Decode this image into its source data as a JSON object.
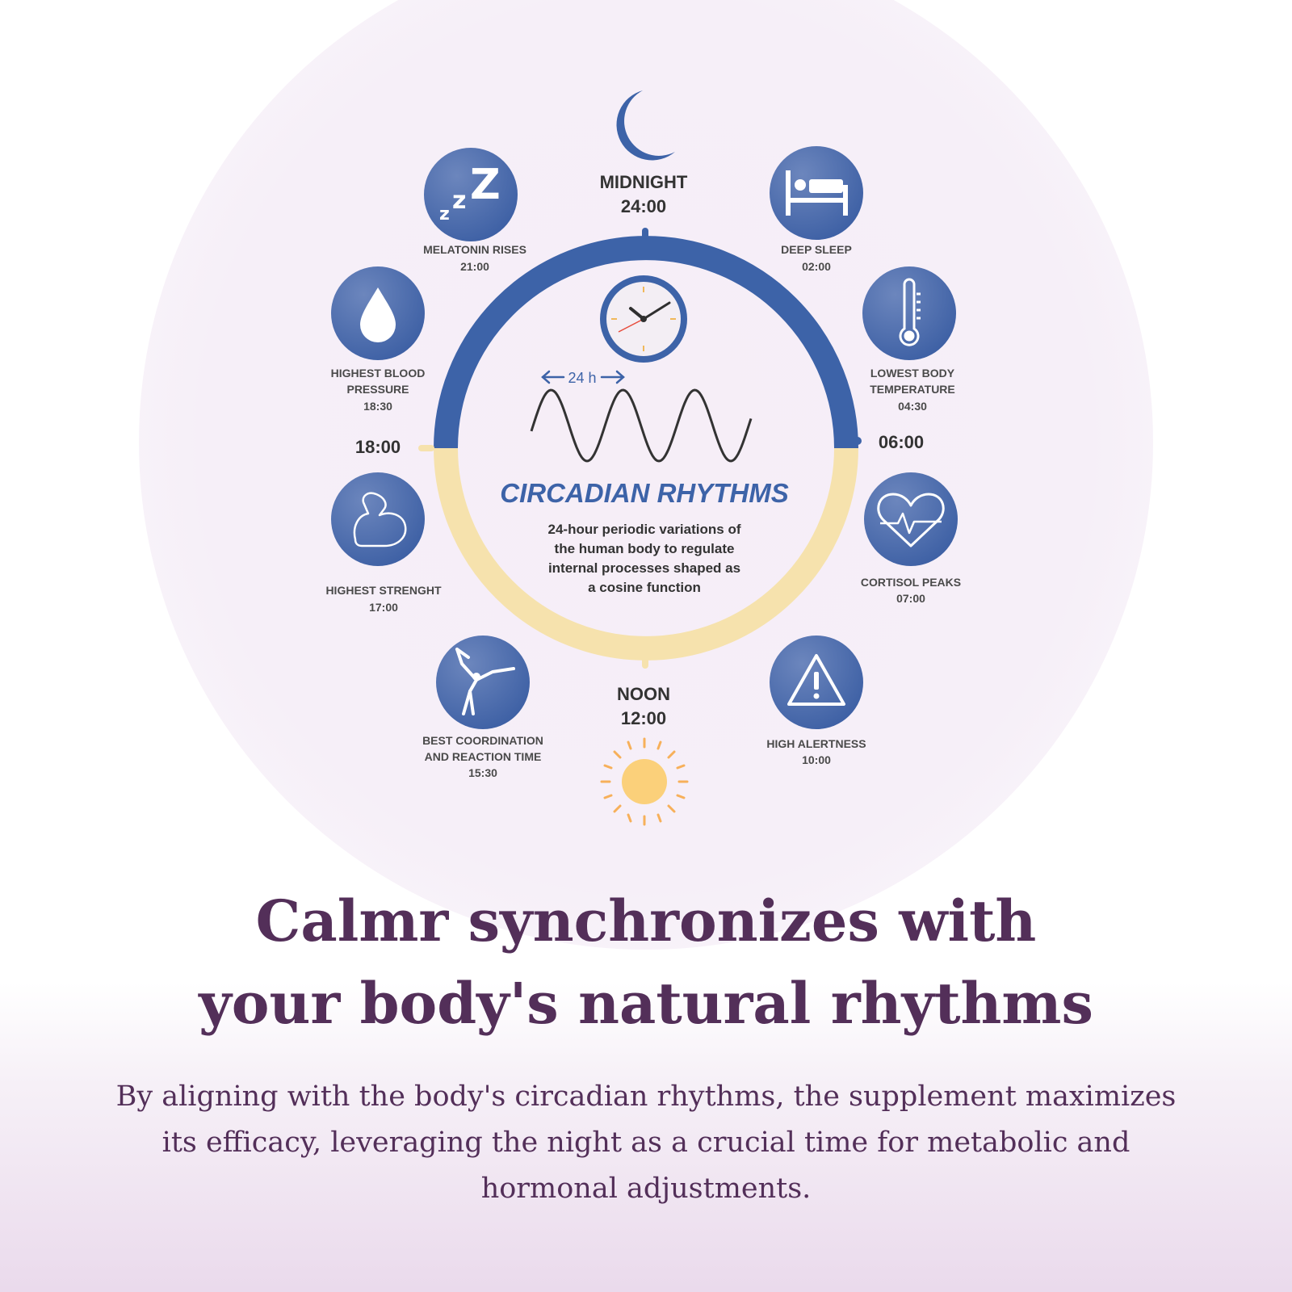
{
  "diagram": {
    "midnight": {
      "label": "MIDNIGHT",
      "time": "24:00"
    },
    "noon": {
      "label": "NOON",
      "time": "12:00"
    },
    "left_time": "18:00",
    "right_time": "06:00",
    "center": {
      "span_label": "24 h",
      "title": "CIRCADIAN RHYTHMS",
      "desc_lines": [
        "24-hour periodic variations of",
        "the human body to regulate",
        "internal processes shaped as",
        "a cosine function"
      ]
    },
    "events": [
      {
        "id": "melatonin",
        "icon": "zzz-icon",
        "lines": [
          "MELATONIN RISES"
        ],
        "time": "21:00"
      },
      {
        "id": "deep-sleep",
        "icon": "bed-icon",
        "lines": [
          "DEEP SLEEP"
        ],
        "time": "02:00"
      },
      {
        "id": "blood-pressure",
        "icon": "water-drop-icon",
        "lines": [
          "HIGHEST BLOOD",
          "PRESSURE"
        ],
        "time": "18:30"
      },
      {
        "id": "body-temp",
        "icon": "thermometer-icon",
        "lines": [
          "LOWEST BODY",
          "TEMPERATURE"
        ],
        "time": "04:30"
      },
      {
        "id": "strength",
        "icon": "bicep-icon",
        "lines": [
          "HIGHEST STRENGHT"
        ],
        "time": "17:00"
      },
      {
        "id": "cortisol",
        "icon": "heartbeat-icon",
        "lines": [
          "CORTISOL PEAKS"
        ],
        "time": "07:00"
      },
      {
        "id": "coordination",
        "icon": "yoga-pose-icon",
        "lines": [
          "BEST COORDINATION",
          "AND REACTION TIME"
        ],
        "time": "15:30"
      },
      {
        "id": "alertness",
        "icon": "warning-icon",
        "lines": [
          "HIGH ALERTNESS"
        ],
        "time": "10:00"
      }
    ],
    "colors": {
      "night_arc": "#3d63a8",
      "day_arc": "#f6e2ad",
      "icon_circle": "#4566a9",
      "sun": "#fbd07a"
    }
  },
  "headline": {
    "line1": "Calmr synchronizes with",
    "line2": "your body's natural rhythms"
  },
  "body": {
    "line1": "By aligning with the body's circadian rhythms, the supplement maximizes",
    "line2": "its efficacy, leveraging the night as a crucial time for metabolic and",
    "line3": "hormonal adjustments."
  }
}
